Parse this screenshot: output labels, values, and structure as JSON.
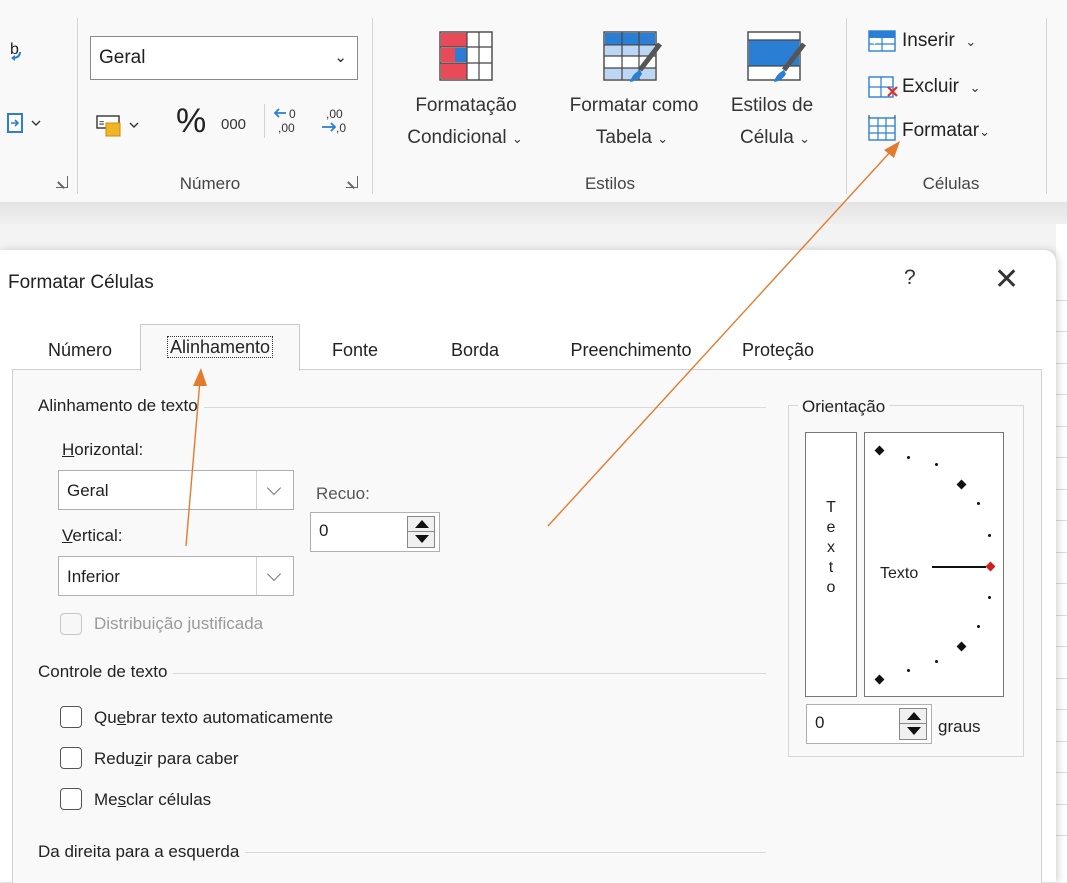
{
  "ribbon": {
    "numfmt_value": "Geral",
    "percent_glyph": "%",
    "thousands_glyph": "000",
    "group_number_label": "Número",
    "styles": {
      "cond_line1": "Formatação",
      "cond_line2": "Condicional",
      "table_line1": "Formatar como",
      "table_line2": "Tabela",
      "cell_line1": "Estilos de",
      "cell_line2": "Célula",
      "group_label": "Estilos"
    },
    "cells": {
      "insert": "Inserir",
      "delete": "Excluir",
      "format": "Formatar",
      "group_label": "Células"
    },
    "colors": {
      "accent_red": "#e84b57",
      "accent_blue": "#2a7fd4"
    }
  },
  "dialog": {
    "title": "Formatar Células",
    "help": "?",
    "close": "✕",
    "tabs": [
      "Número",
      "Alinhamento",
      "Fonte",
      "Borda",
      "Preenchimento",
      "Proteção"
    ],
    "active_tab": "Alinhamento",
    "text_alignment": {
      "section": "Alinhamento de texto",
      "horizontal_label_u": "H",
      "horizontal_label_rest": "orizontal:",
      "horizontal_value": "Geral",
      "vertical_label_u": "V",
      "vertical_label_rest": "ertical:",
      "vertical_value": "Inferior",
      "indent_label": "Recuo:",
      "indent_value": "0",
      "justify_distributed": "Distribuição justificada"
    },
    "text_control": {
      "section": "Controle de texto",
      "wrap_pre": "Qu",
      "wrap_u": "e",
      "wrap_post": "brar texto automaticamente",
      "shrink_pre": "Redu",
      "shrink_u": "z",
      "shrink_post": "ir para caber",
      "merge_pre": "Me",
      "merge_u": "s",
      "merge_post": "clar células"
    },
    "rtl": {
      "section": "Da direita para a esquerda"
    },
    "orientation": {
      "section": "Orientação",
      "vertical_letters": [
        "T",
        "e",
        "x",
        "t",
        "o"
      ],
      "dial_text": "Texto",
      "degrees_value": "0",
      "degrees_label_u": "g",
      "degrees_label_rest": "raus",
      "colors": {
        "marker_red": "#cc1f1f"
      }
    }
  },
  "annotations": {
    "arrow_color": "#e37b2e"
  }
}
